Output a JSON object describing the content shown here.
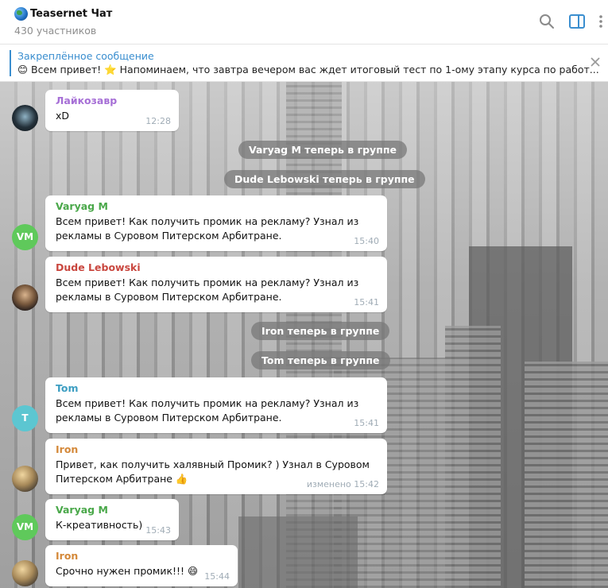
{
  "header": {
    "title": "Teasernet Чат",
    "subtitle": "430 участников",
    "icons": [
      "search-icon",
      "sidebar-toggle-icon",
      "more-vertical-icon"
    ]
  },
  "pinned": {
    "title": "Закреплённое сообщение",
    "text": "😊 Всем привет!  ⭐  Напоминаем, что завтра вечером вас ждет итоговый тест по 1-ому этапу курса по работ..."
  },
  "messages": [
    {
      "sender": "Лайкозавр",
      "sender_color": "#a66fd6",
      "text": "xD",
      "time": "12:28"
    },
    {
      "service": "Varyag M теперь в группе"
    },
    {
      "service": "Dude Lebowski теперь в группе"
    },
    {
      "sender": "Varyag M",
      "sender_color": "#4aa84a",
      "avatar_initials": "VM",
      "avatar_color": "#5fc95b",
      "text": "Всем привет! Как получить промик на рекламу? Узнал из рекламы в Суровом Питерском Арбитране.",
      "time": "15:40"
    },
    {
      "sender": "Dude Lebowski",
      "sender_color": "#c9473f",
      "text": "Всем привет! Как получить промик на рекламу? Узнал из рекламы в Суровом Питерском Арбитране.",
      "time": "15:41"
    },
    {
      "service": "Iron теперь в группе"
    },
    {
      "service": "Tom теперь в группе"
    },
    {
      "sender": "Tom",
      "sender_color": "#3d9ec2",
      "avatar_initials": "T",
      "avatar_color": "#5cc6d1",
      "text": "Всем привет! Как получить промик на рекламу? Узнал из рекламы в Суровом Питерском Арбитране.",
      "time": "15:41"
    },
    {
      "sender": "Iron",
      "sender_color": "#d4893a",
      "text": "Привет, как получить халявный Промик? ) Узнал в Суровом Питерском Арбитране 👍",
      "time": "изменено 15:42"
    },
    {
      "sender": "Varyag M",
      "sender_color": "#4aa84a",
      "avatar_initials": "VM",
      "avatar_color": "#5fc95b",
      "text": "К-креативность)",
      "time": "15:43"
    },
    {
      "sender": "Iron",
      "sender_color": "#d4893a",
      "text": "Срочно нужен промик!!! 😄",
      "time": "15:44"
    }
  ]
}
